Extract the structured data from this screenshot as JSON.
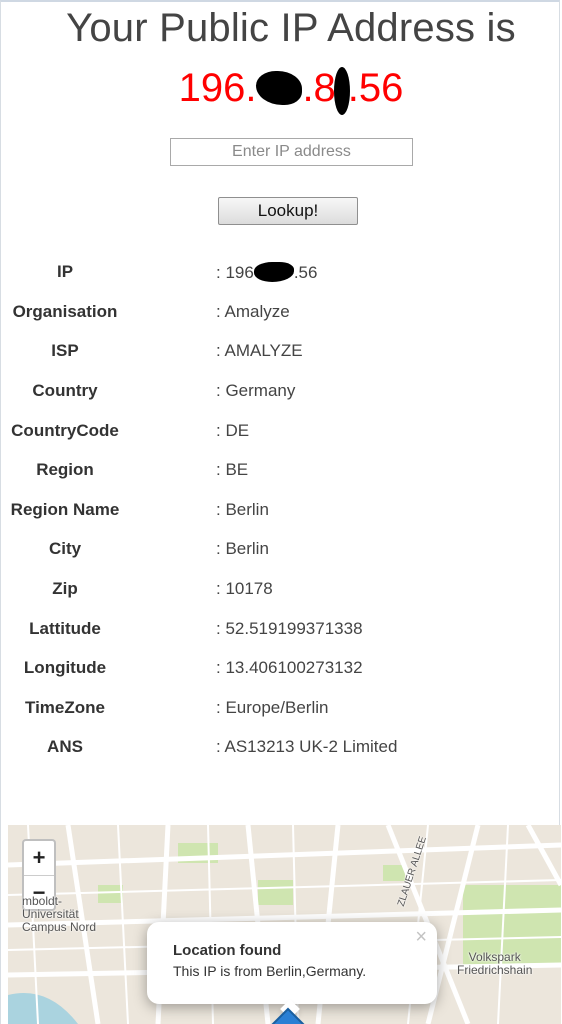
{
  "header": {
    "title": "Your Public IP Address is",
    "ip_prefix": "196.",
    "ip_mid": ".8",
    "ip_suffix": ".56",
    "ip_color": "#ff0000"
  },
  "lookup": {
    "placeholder": "Enter IP address",
    "button_label": "Lookup!"
  },
  "info": [
    {
      "label": "IP",
      "value": ".56",
      "value_prefix": "196"
    },
    {
      "label": "Organisation",
      "value": ": Amalyze"
    },
    {
      "label": "ISP",
      "value": ": AMALYZE"
    },
    {
      "label": "Country",
      "value": ": Germany"
    },
    {
      "label": "CountryCode",
      "value": ": DE"
    },
    {
      "label": "Region",
      "value": ": BE"
    },
    {
      "label": "Region Name",
      "value": ": Berlin"
    },
    {
      "label": "City",
      "value": ": Berlin"
    },
    {
      "label": "Zip",
      "value": ": 10178"
    },
    {
      "label": "Lattitude",
      "value": ": 52.519199371338"
    },
    {
      "label": "Longitude",
      "value": ": 13.406100273132"
    },
    {
      "label": "TimeZone",
      "value": ": Europe/Berlin"
    },
    {
      "label": "ANS",
      "value": ": AS13213 UK-2 Limited"
    }
  ],
  "map": {
    "zoom_in": "+",
    "zoom_out": "−",
    "labels": {
      "humboldt": "mboldt-\nUniversität\nCampus Nord",
      "volkspark": "Volkspark\nFriedrichshain",
      "street": "ZLAUER ALLEE"
    },
    "popup": {
      "title": "Location found",
      "text": "This IP is from Berlin,Germany.",
      "close": "×"
    },
    "colors": {
      "land": "#ece6dc",
      "road": "#ffffff",
      "park": "#cfe5b0",
      "water": "#aad3df",
      "marker": "#2a7fd4"
    }
  }
}
